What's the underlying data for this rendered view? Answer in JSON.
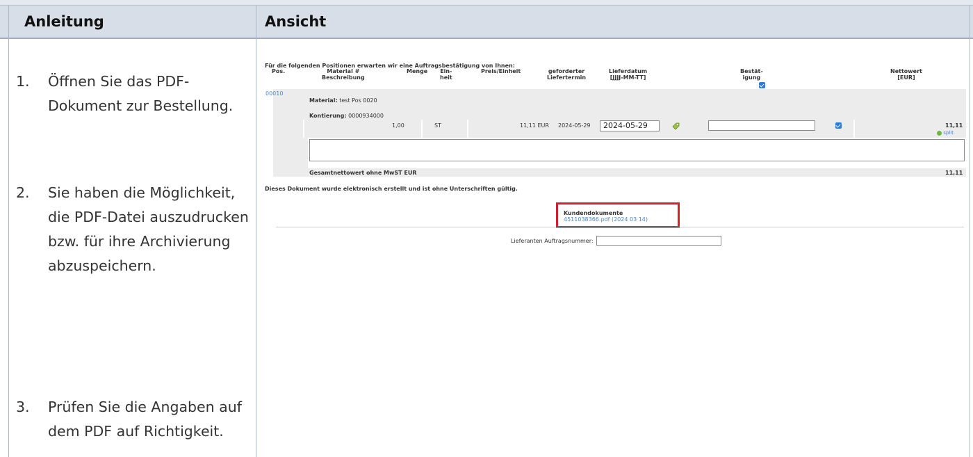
{
  "table": {
    "head_left": "Anleitung",
    "head_right": "Ansicht"
  },
  "steps": [
    {
      "num": "1.",
      "text": "Öffnen Sie das PDF-Dokument zur Bestellung."
    },
    {
      "num": "2.",
      "text": "Sie haben die Möglichkeit, die PDF-Datei auszudrucken bzw. für ihre Archivierung abzuspeichern."
    },
    {
      "num": "3.",
      "text": "Prüfen Sie die Angaben auf dem PDF auf Richtigkeit."
    }
  ],
  "portal": {
    "intro": "Für die folgenden Positionen erwarten wir eine Auftragsbestätigung von Ihnen:",
    "columns": {
      "pos": "Pos.",
      "material": "Material #",
      "beschreibung": "Beschreibung",
      "menge": "Menge",
      "einheit": "Ein-\nheit",
      "preis": "Preis/Einheit",
      "termin": "geforderter\nLiefertermin",
      "lieferdatum": "Lieferdatum\n[JJJJ-MM-TT]",
      "bestaetigung": "Bestät-\nigung",
      "nettowert": "Nettowert\n[EUR]"
    },
    "item": {
      "pos": "00010",
      "material_label": "Material:",
      "material_value": "test Pos 0020",
      "kontierung_label": "Kontierung:",
      "kontierung_value": "0000934000",
      "menge": "1,00",
      "einheit": "ST",
      "preis": "11,11 EUR",
      "termin": "2024-05-29",
      "lieferdatum": "2024-05-29",
      "nettowert": "11,11",
      "split": "split"
    },
    "total_label": "Gesamtnettowert ohne MwST EUR",
    "total_value": "11,11",
    "notice": "Dieses Dokument wurde elektronisch erstellt und ist ohne Unterschriften gültig.",
    "kunden_title": "Kundendokumente",
    "kunden_file": "4511038366.pdf (2024 03 14)",
    "auftragsnummer_label": "Lieferanten Auftragsnummer:",
    "auftragsnummer_value": ""
  },
  "colors": {
    "header_bg": "#d7dee8",
    "link": "#4a86c5",
    "highlight": "#d3202a",
    "checkbox": "#2e7ad8"
  }
}
